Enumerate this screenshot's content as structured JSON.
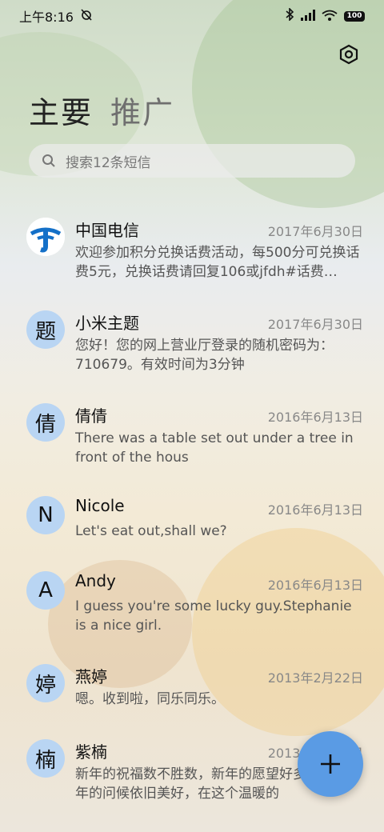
{
  "status_bar": {
    "time": "上午8:16",
    "battery": "100"
  },
  "tabs": [
    {
      "label": "主要"
    },
    {
      "label": "推广"
    }
  ],
  "search": {
    "placeholder": "搜索12条短信"
  },
  "conversations": [
    {
      "avatar": "",
      "avatar_kind": "china-telecom-logo",
      "name": "中国电信",
      "date": "2017年6月30日",
      "snippet": "欢迎参加积分兑换话费活动，每500分可兑换话费5元，兑换话费请回复106或jfdh#话费…"
    },
    {
      "avatar": "题",
      "name": "小米主题",
      "date": "2017年6月30日",
      "snippet": "您好！您的网上营业厅登录的随机密码为：710679。有效时间为3分钟"
    },
    {
      "avatar": "倩",
      "name": "倩倩",
      "date": "2016年6月13日",
      "snippet": "There was a table set out under a tree in front of the hous"
    },
    {
      "avatar": "N",
      "name": "Nicole",
      "date": "2016年6月13日",
      "snippet": "Let's eat out,shall we?"
    },
    {
      "avatar": "A",
      "name": "Andy",
      "date": "2016年6月13日",
      "snippet": "I guess you're some lucky guy.Stephanie is a nice girl."
    },
    {
      "avatar": "婷",
      "name": "燕婷",
      "date": "2013年2月22日",
      "snippet": "嗯。收到啦，同乐同乐。"
    },
    {
      "avatar": "楠",
      "name": "紫楠",
      "date": "2013年2月22日",
      "snippet": "新年的祝福数不胜数，新年的愿望好多好多，新年的问候依旧美好，在这个温暖的"
    }
  ],
  "colors": {
    "avatar_bg": "#b9d5f3",
    "fab": "#5a9be4"
  }
}
